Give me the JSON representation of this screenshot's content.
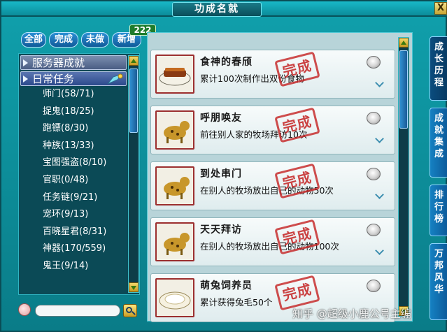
{
  "window": {
    "title": "功成名就",
    "close_label": "X"
  },
  "filters": [
    "全部",
    "完成",
    "未做",
    "新增"
  ],
  "new_count": "222",
  "categories": [
    {
      "label": "服务器成就",
      "open": false
    },
    {
      "label": "日常任务",
      "open": true
    }
  ],
  "items": [
    {
      "label": "师门(58/71)"
    },
    {
      "label": "捉鬼(18/25)"
    },
    {
      "label": "跑镖(8/30)"
    },
    {
      "label": "种族(13/33)"
    },
    {
      "label": "宝图强盗(8/10)"
    },
    {
      "label": "官职(0/48)"
    },
    {
      "label": "任务链(9/21)"
    },
    {
      "label": "宠环(9/13)"
    },
    {
      "label": "百晓星君(8/31)"
    },
    {
      "label": "神器(170/559)"
    },
    {
      "label": "鬼王(9/14)"
    }
  ],
  "achievements": [
    {
      "title": "食神的春颀",
      "desc": "累计100次制作出双份食物",
      "stamp": "完成",
      "icon": "cooked-food-icon"
    },
    {
      "title": "呼朋唤友",
      "desc": "前往别人家的牧场拜访10次",
      "stamp": "完成",
      "icon": "dog-pet-icon"
    },
    {
      "title": "到处串门",
      "desc": "在别人的牧场放出自己的动物50次",
      "stamp": "完成",
      "icon": "dog-pet-icon"
    },
    {
      "title": "天天拜访",
      "desc": "在别人的牧场放出自己的动物100次",
      "stamp": "完成",
      "icon": "dog-pet-icon"
    },
    {
      "title": "萌兔饲养员",
      "desc": "累计获得兔毛50个",
      "stamp": "完成",
      "icon": "rabbit-fur-icon"
    }
  ],
  "right_tabs": [
    "成长历程",
    "成就集成",
    "排行榜",
    "万邦风华"
  ],
  "watermark": "知乎 @超级小鹿公号主编"
}
